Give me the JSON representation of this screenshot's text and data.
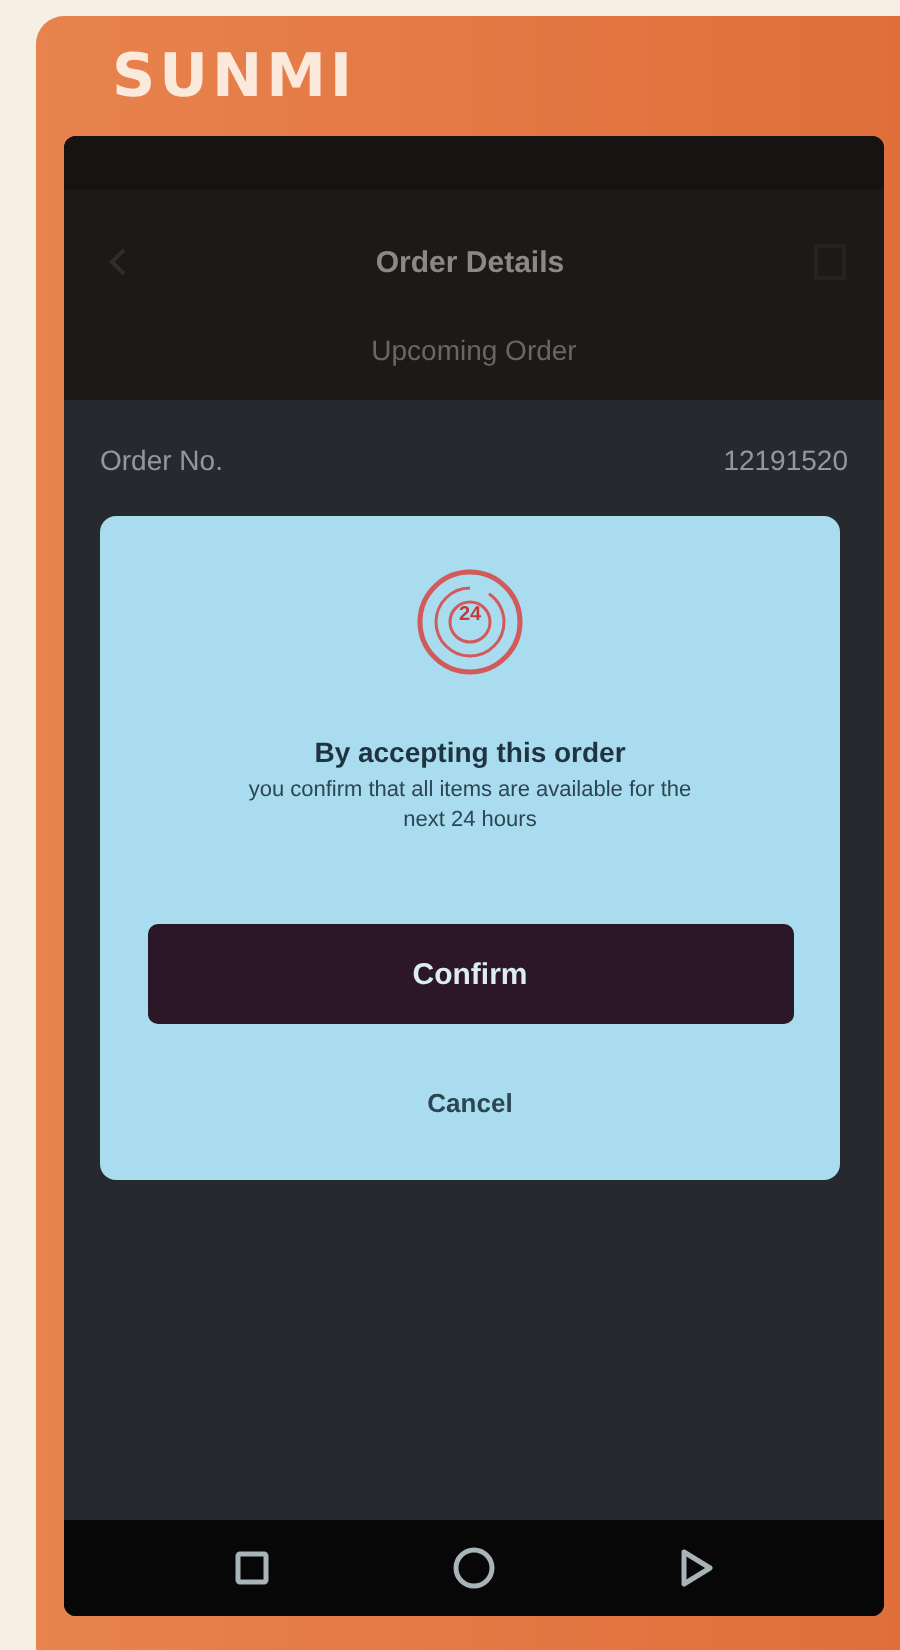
{
  "device": {
    "logo": "SUNMI"
  },
  "app_bar": {
    "title": "Order Details",
    "subtitle": "Upcoming Order"
  },
  "order_rows": [
    {
      "label": "Order No.",
      "value": "12191520"
    }
  ],
  "dialog": {
    "badge": "24",
    "title": "By accepting this order",
    "message": "you confirm that all items are available for the next 24 hours",
    "confirm": "Confirm",
    "cancel": "Cancel"
  }
}
